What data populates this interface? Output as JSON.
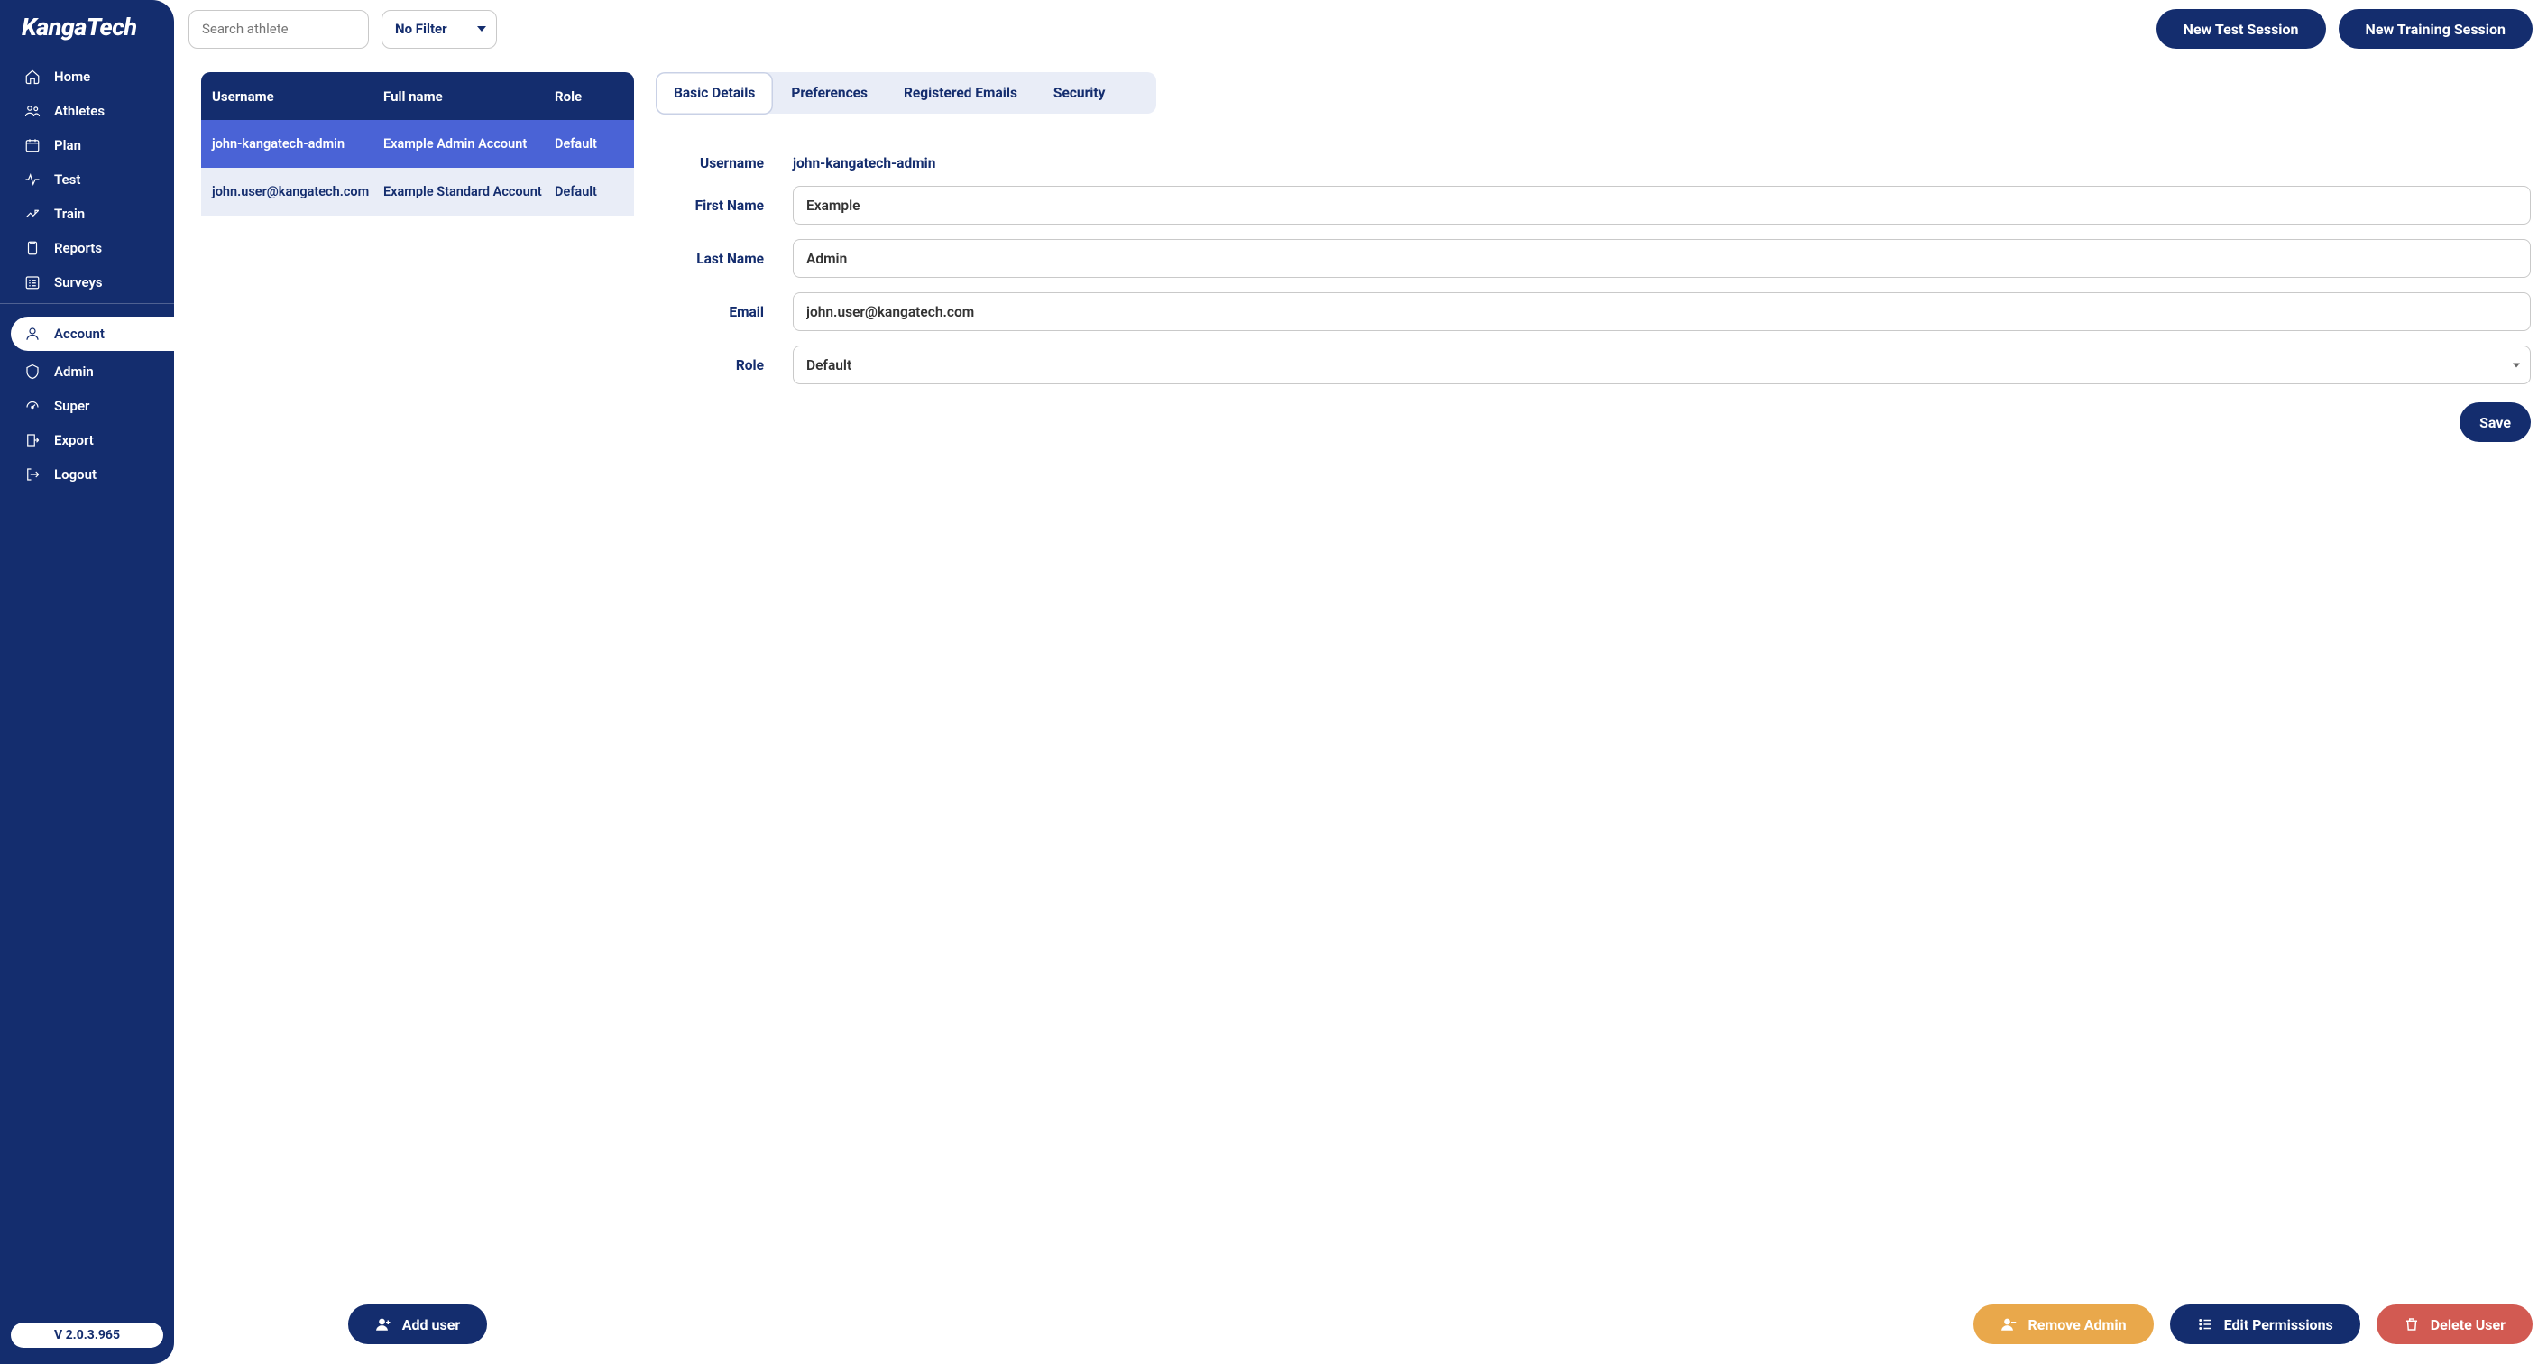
{
  "app": {
    "logo": "KangaTech",
    "version": "V 2.0.3.965"
  },
  "sidebar": {
    "group1": [
      {
        "id": "home",
        "label": "Home"
      },
      {
        "id": "athletes",
        "label": "Athletes"
      },
      {
        "id": "plan",
        "label": "Plan"
      },
      {
        "id": "test",
        "label": "Test"
      },
      {
        "id": "train",
        "label": "Train"
      },
      {
        "id": "reports",
        "label": "Reports"
      },
      {
        "id": "surveys",
        "label": "Surveys"
      }
    ],
    "group2": [
      {
        "id": "account",
        "label": "Account",
        "active": true
      },
      {
        "id": "admin",
        "label": "Admin"
      },
      {
        "id": "super",
        "label": "Super"
      },
      {
        "id": "export",
        "label": "Export"
      },
      {
        "id": "logout",
        "label": "Logout"
      }
    ]
  },
  "topbar": {
    "search_placeholder": "Search athlete",
    "filter_value": "No Filter",
    "new_test_label": "New Test Session",
    "new_training_label": "New Training Session"
  },
  "user_table": {
    "headers": {
      "username": "Username",
      "fullname": "Full name",
      "role": "Role"
    },
    "rows": [
      {
        "username": "john-kangatech-admin",
        "fullname": "Example Admin Account",
        "role": "Default",
        "selected": true
      },
      {
        "username": "john.user@kangatech.com",
        "fullname": "Example Standard Account",
        "role": "Default",
        "selected": false
      }
    ]
  },
  "tabs": [
    {
      "id": "basic",
      "label": "Basic Details",
      "active": true
    },
    {
      "id": "preferences",
      "label": "Preferences"
    },
    {
      "id": "emails",
      "label": "Registered Emails"
    },
    {
      "id": "security",
      "label": "Security"
    }
  ],
  "form": {
    "username_label": "Username",
    "username_value": "john-kangatech-admin",
    "firstname_label": "First Name",
    "firstname_value": "Example",
    "lastname_label": "Last Name",
    "lastname_value": "Admin",
    "email_label": "Email",
    "email_value": "john.user@kangatech.com",
    "role_label": "Role",
    "role_value": "Default",
    "save_label": "Save"
  },
  "footer": {
    "add_user": "Add user",
    "remove_admin": "Remove Admin",
    "edit_permissions": "Edit Permissions",
    "delete_user": "Delete User"
  }
}
